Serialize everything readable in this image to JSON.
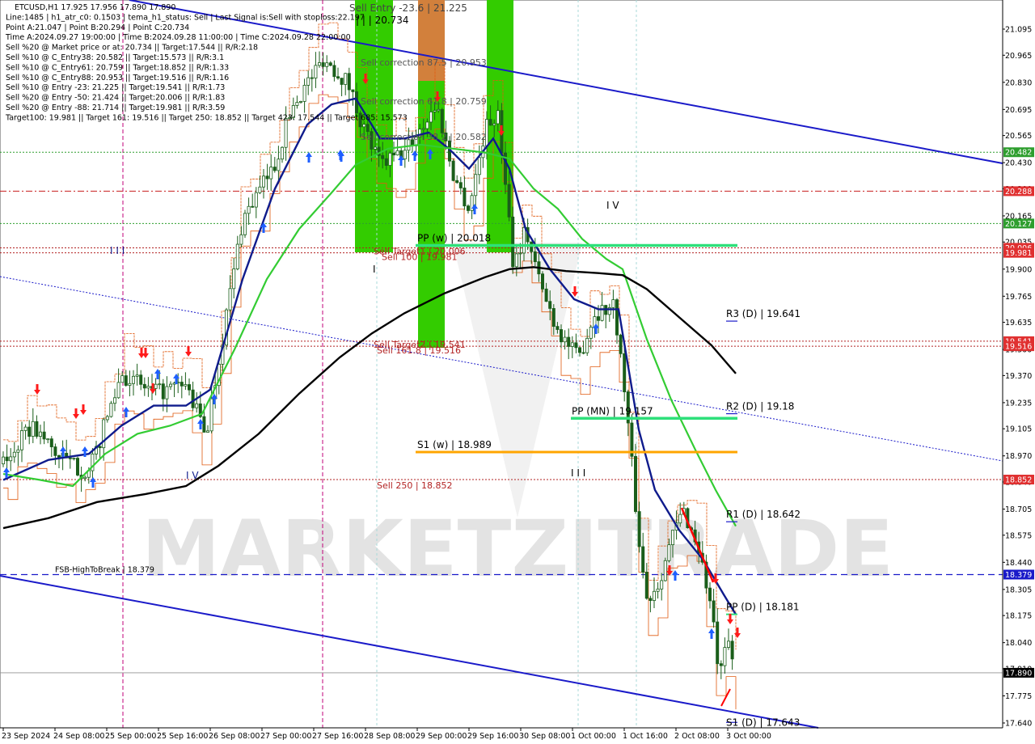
{
  "info": [
    "ETCUSD,H1  17.925 17.956 17.890 17.890",
    "Line:1485 | h1_atr_c0: 0.1503 | tema_h1_status: Sell | Last Signal is:Sell with stoploss:22.197",
    "Point A:21.047 | Point B:20.294 | Point C:20.734",
    "Time A:2024.09.27 19:00:00 | Time B:2024.09.28 11:00:00 | Time C:2024.09.28 22:00:00",
    "Sell %20 @ Market price or at: 20.734 || Target:17.544 || R/R:2.18",
    "Sell %10 @ C_Entry38: 20.582 || Target:15.573 || R/R:3.1",
    "Sell %10 @ C_Entry61: 20.759 || Target:18.852 || R/R:1.33",
    "Sell %10 @ C_Entry88: 20.953 || Target:19.516 || R/R:1.16",
    "Sell %10 @ Entry -23: 21.225 || Target:19.541 || R/R:1.73",
    "Sell %20 @ Entry -50: 21.424 || Target:20.006 || R/R:1.83",
    "Sell %20 @ Entry -88: 21.714 || Target:19.981 || R/R:3.59",
    "Target100: 19.981 || Target 161: 19.516 || Target 250: 18.852 || Target 423: 17.544 || Target 685: 15.573"
  ],
  "watermark": "MARKETZITRADE",
  "colors": {
    "ma_blue": "#0f1b8c",
    "ma_green": "#33cc33",
    "ma_black": "#000000",
    "candle": "#1a5e1a",
    "channel": "#1a1ac9",
    "pivot_green": "#2ee07a",
    "pivot_orange": "#ffa500",
    "signal_green": "#33cc00",
    "signal_orange": "#d2803c",
    "dark_red": "#b22222",
    "arrow_blue": "#1e5fff",
    "arrow_red": "#ff1a1a",
    "tag_blue": "#1a1ac9",
    "tag_red": "#e03030",
    "tag_green": "#2e9e2e",
    "tag_black": "#000000"
  },
  "chart_data": {
    "type": "candlestick",
    "symbol": "ETCUSD",
    "timeframe": "H1",
    "ylim": [
      17.627,
      21.09
    ],
    "y_ticks": [
      "21.095",
      "20.965",
      "20.830",
      "20.695",
      "20.565",
      "20.430",
      "20.300",
      "20.165",
      "20.035",
      "19.900",
      "19.765",
      "19.635",
      "19.500",
      "19.370",
      "19.235",
      "19.105",
      "18.970",
      "18.840",
      "18.705",
      "18.575",
      "18.440",
      "18.305",
      "18.175",
      "18.040",
      "17.910",
      "17.775",
      "17.640"
    ],
    "x_labels": [
      "23 Sep 2024",
      "24 Sep 08:00",
      "25 Sep 00:00",
      "25 Sep 16:00",
      "26 Sep 08:00",
      "27 Sep 00:00",
      "27 Sep 16:00",
      "28 Sep 08:00",
      "29 Sep 00:00",
      "29 Sep 16:00",
      "30 Sep 08:00",
      "1 Oct 00:00",
      "1 Oct 16:00",
      "2 Oct 08:00",
      "3 Oct 00:00"
    ],
    "price_tags": [
      {
        "value": 20.482,
        "text": "20.482",
        "color": "tag_green"
      },
      {
        "value": 20.288,
        "text": "20.288",
        "color": "tag_red"
      },
      {
        "value": 20.127,
        "text": "20.127",
        "color": "tag_green"
      },
      {
        "value": 20.006,
        "text": "20.006",
        "color": "tag_red"
      },
      {
        "value": 19.981,
        "text": "19.981",
        "color": "tag_red"
      },
      {
        "value": 19.541,
        "text": "19.541",
        "color": "tag_red"
      },
      {
        "value": 19.516,
        "text": "19.516",
        "color": "tag_red"
      },
      {
        "value": 18.852,
        "text": "18.852",
        "color": "tag_red"
      },
      {
        "value": 18.379,
        "text": "18.379",
        "color": "tag_blue"
      },
      {
        "value": 17.89,
        "text": "17.890",
        "color": "tag_black"
      }
    ],
    "pivots": [
      {
        "label": "PP (w) | 20.018",
        "value": 20.018,
        "color": "pivot_green"
      },
      {
        "label": "PP (MN) | 19.157",
        "value": 19.157,
        "color": "pivot_green"
      },
      {
        "label": "S1 (w) | 18.989",
        "value": 18.989,
        "color": "pivot_orange"
      },
      {
        "label": "R3 (D) | 19.641",
        "value": 19.641,
        "color": "ma_blue"
      },
      {
        "label": "R2 (D) | 19.18",
        "value": 19.18,
        "color": "ma_blue"
      },
      {
        "label": "R1 (D) | 18.642",
        "value": 18.642,
        "color": "ma_blue"
      },
      {
        "label": "PP (D) | 18.181",
        "value": 18.181,
        "color": "ma_blue"
      },
      {
        "label": "S1 (D) | 17.643",
        "value": 17.643,
        "color": "ma_blue"
      }
    ],
    "levels": [
      {
        "label": "Sell Target1 | 20.006",
        "value": 20.006
      },
      {
        "label": "Sell 100 | 19.981",
        "value": 19.981
      },
      {
        "label": "Sell Target2 | 19.541",
        "value": 19.541
      },
      {
        "label": "Sell 161.8 | 19.516",
        "value": 19.516
      },
      {
        "label": "Sell 250 | 18.852",
        "value": 18.852
      },
      {
        "label": "FSB-HighToBreak | 18.379",
        "value": 18.379
      }
    ],
    "entry_labels": [
      {
        "label": "Sell Entry -23.6 | 21.225"
      },
      {
        "label": "| | | 20.734"
      },
      {
        "label": "Sell correction 87.5 | 20.953"
      },
      {
        "label": "Sell correction 61.8 | 20.759"
      },
      {
        "label": "Sell correction 38.2 | 20.582"
      }
    ],
    "wave_labels": [
      "I I I",
      "I V",
      "I V",
      "I",
      "I I I",
      "V"
    ]
  }
}
